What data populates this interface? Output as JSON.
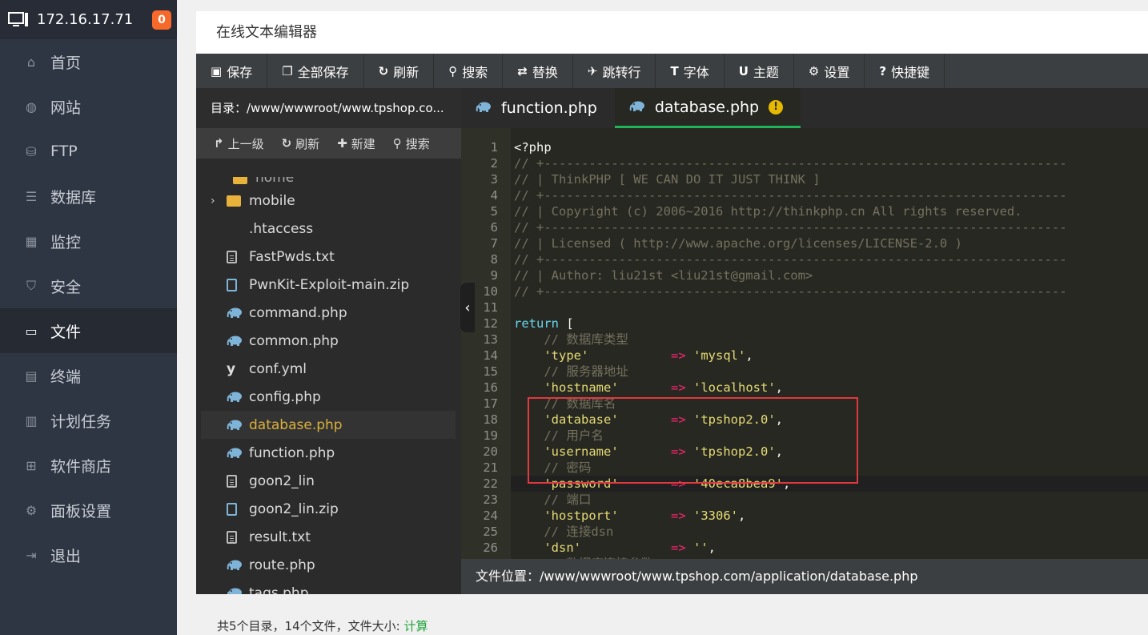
{
  "sidebar": {
    "host": "172.16.17.71",
    "badge": "0",
    "items": [
      {
        "label": "首页",
        "icon": "home-icon"
      },
      {
        "label": "网站",
        "icon": "globe-icon"
      },
      {
        "label": "FTP",
        "icon": "ftp-icon"
      },
      {
        "label": "数据库",
        "icon": "database-icon"
      },
      {
        "label": "监控",
        "icon": "monitor-icon"
      },
      {
        "label": "安全",
        "icon": "shield-icon"
      },
      {
        "label": "文件",
        "icon": "folder-icon",
        "active": true
      },
      {
        "label": "终端",
        "icon": "terminal-icon"
      },
      {
        "label": "计划任务",
        "icon": "calendar-icon"
      },
      {
        "label": "软件商店",
        "icon": "apps-icon"
      },
      {
        "label": "面板设置",
        "icon": "gear-icon"
      },
      {
        "label": "退出",
        "icon": "logout-icon"
      }
    ]
  },
  "window": {
    "title": "在线文本编辑器"
  },
  "toolbar": {
    "save": "保存",
    "save_all": "全部保存",
    "refresh": "刷新",
    "search": "搜索",
    "replace": "替换",
    "goto_line": "跳转行",
    "font": "字体",
    "theme": "主题",
    "settings": "设置",
    "shortcuts": "快捷键"
  },
  "filepane": {
    "path": "目录：/www/wwwroot/www.tpshop.co...",
    "tools": {
      "up": "上一级",
      "refresh": "刷新",
      "new": "新建",
      "search": "搜索"
    },
    "partial_item": "home",
    "files": [
      {
        "name": "mobile",
        "type": "folder"
      },
      {
        "name": ".htaccess",
        "type": "none"
      },
      {
        "name": "FastPwds.txt",
        "type": "text"
      },
      {
        "name": "PwnKit-Exploit-main.zip",
        "type": "zip"
      },
      {
        "name": "command.php",
        "type": "php"
      },
      {
        "name": "common.php",
        "type": "php"
      },
      {
        "name": "conf.yml",
        "type": "yml"
      },
      {
        "name": "config.php",
        "type": "php"
      },
      {
        "name": "database.php",
        "type": "php",
        "selected": true
      },
      {
        "name": "function.php",
        "type": "php"
      },
      {
        "name": "goon2_lin",
        "type": "text"
      },
      {
        "name": "goon2_lin.zip",
        "type": "zip"
      },
      {
        "name": "result.txt",
        "type": "text"
      },
      {
        "name": "route.php",
        "type": "php"
      },
      {
        "name": "tags.php",
        "type": "php"
      }
    ]
  },
  "tabs": [
    {
      "label": "function.php",
      "active": false
    },
    {
      "label": "database.php",
      "active": true,
      "modified": true
    }
  ],
  "editor": {
    "lines": [
      [
        [
          "t",
          "<?php"
        ]
      ],
      [
        [
          "c",
          "// +----------------------------------------------------------------------"
        ]
      ],
      [
        [
          "c",
          "// | ThinkPHP [ WE CAN DO IT JUST THINK ]"
        ]
      ],
      [
        [
          "c",
          "// +----------------------------------------------------------------------"
        ]
      ],
      [
        [
          "c",
          "// | Copyright (c) 2006~2016 http://thinkphp.cn All rights reserved."
        ]
      ],
      [
        [
          "c",
          "// +----------------------------------------------------------------------"
        ]
      ],
      [
        [
          "c",
          "// | Licensed ( http://www.apache.org/licenses/LICENSE-2.0 )"
        ]
      ],
      [
        [
          "c",
          "// +----------------------------------------------------------------------"
        ]
      ],
      [
        [
          "c",
          "// | Author: liu21st <liu21st@gmail.com>"
        ]
      ],
      [
        [
          "c",
          "// +----------------------------------------------------------------------"
        ]
      ],
      [
        [
          "t",
          ""
        ]
      ],
      [
        [
          "k",
          "return"
        ],
        [
          "t",
          " ["
        ]
      ],
      [
        [
          "c",
          "    // 数据库类型"
        ]
      ],
      [
        [
          "t",
          "    "
        ],
        [
          "s",
          "'type'"
        ],
        [
          "t",
          "           "
        ],
        [
          "o",
          "=>"
        ],
        [
          "t",
          " "
        ],
        [
          "s",
          "'mysql'"
        ],
        [
          "t",
          ","
        ]
      ],
      [
        [
          "c",
          "    // 服务器地址"
        ]
      ],
      [
        [
          "t",
          "    "
        ],
        [
          "s",
          "'hostname'"
        ],
        [
          "t",
          "       "
        ],
        [
          "o",
          "=>"
        ],
        [
          "t",
          " "
        ],
        [
          "s",
          "'localhost'"
        ],
        [
          "t",
          ","
        ]
      ],
      [
        [
          "c",
          "    // 数据库名"
        ]
      ],
      [
        [
          "t",
          "    "
        ],
        [
          "s",
          "'database'"
        ],
        [
          "t",
          "       "
        ],
        [
          "o",
          "=>"
        ],
        [
          "t",
          " "
        ],
        [
          "s",
          "'tpshop2.0'"
        ],
        [
          "t",
          ","
        ]
      ],
      [
        [
          "c",
          "    // 用户名"
        ]
      ],
      [
        [
          "t",
          "    "
        ],
        [
          "s",
          "'username'"
        ],
        [
          "t",
          "       "
        ],
        [
          "o",
          "=>"
        ],
        [
          "t",
          " "
        ],
        [
          "s",
          "'tpshop2.0'"
        ],
        [
          "t",
          ","
        ]
      ],
      [
        [
          "c",
          "    // 密码"
        ]
      ],
      [
        [
          "t",
          "    "
        ],
        [
          "s",
          "'password'"
        ],
        [
          "t",
          "       "
        ],
        [
          "o",
          "=>"
        ],
        [
          "t",
          " "
        ],
        [
          "s",
          "'40eca8bea9'"
        ],
        [
          "t",
          ","
        ]
      ],
      [
        [
          "c",
          "    // 端口"
        ]
      ],
      [
        [
          "t",
          "    "
        ],
        [
          "s",
          "'hostport'"
        ],
        [
          "t",
          "       "
        ],
        [
          "o",
          "=>"
        ],
        [
          "t",
          " "
        ],
        [
          "s",
          "'3306'"
        ],
        [
          "t",
          ","
        ]
      ],
      [
        [
          "c",
          "    // 连接dsn"
        ]
      ],
      [
        [
          "t",
          "    "
        ],
        [
          "s",
          "'dsn'"
        ],
        [
          "t",
          "            "
        ],
        [
          "o",
          "=>"
        ],
        [
          "t",
          " "
        ],
        [
          "s",
          "''"
        ],
        [
          "t",
          ","
        ]
      ],
      [
        [
          "c",
          "    // 数据库连接参数"
        ]
      ]
    ],
    "highlight_line": 22
  },
  "status": {
    "file_location": "文件位置：/www/wwwroot/www.tpshop.com/application/database.php"
  },
  "footer": {
    "summary": "共5个目录，14个文件，文件大小:",
    "calc_link": "计算"
  },
  "colors": {
    "accent_green": "#20a53a",
    "badge_orange": "#f7692b",
    "highlight_box": "#e0393e"
  }
}
